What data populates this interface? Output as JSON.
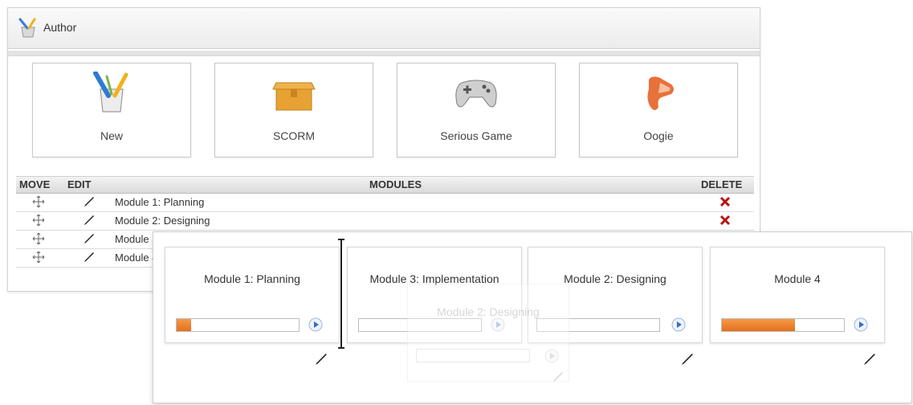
{
  "header": {
    "title": "Author",
    "icon": "pencil-cup-icon"
  },
  "tiles": [
    {
      "label": "New",
      "icon": "pencil-cup-icon"
    },
    {
      "label": "SCORM",
      "icon": "package-box-icon"
    },
    {
      "label": "Serious Game",
      "icon": "gamepad-icon"
    },
    {
      "label": "Oogie",
      "icon": "oogie-logo-icon"
    }
  ],
  "table": {
    "columns": {
      "move": "MOVE",
      "edit": "EDIT",
      "modules": "MODULES",
      "delete": "DELETE"
    },
    "rows": [
      {
        "name": "Module 1: Planning"
      },
      {
        "name": "Module 2: Designing"
      },
      {
        "name": "Module 3"
      },
      {
        "name": "Module 4"
      }
    ]
  },
  "sequence": {
    "cards": [
      {
        "title": "Module 1: Planning",
        "progress": 0.12
      },
      {
        "title": "Module 3: Implementation",
        "progress": 0
      },
      {
        "title": "Module 2: Designing",
        "progress": 0
      },
      {
        "title": "Module 4",
        "progress": 0.6
      }
    ],
    "dragging": {
      "title": "Module 2: Designing"
    }
  },
  "colors": {
    "accent": "#e8741e",
    "delete": "#b51414",
    "play": "#2f6fc9"
  }
}
